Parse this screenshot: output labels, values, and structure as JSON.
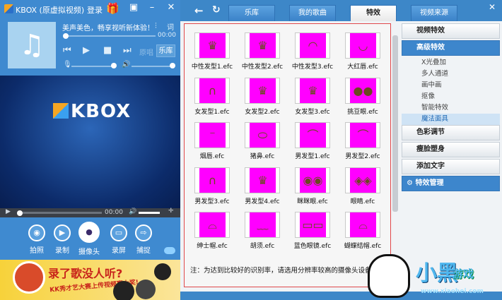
{
  "app": {
    "title": "KBOX (原虚拟视频)",
    "login": "登录",
    "gift_icon": "gift-icon"
  },
  "player": {
    "slogan": "美声美色，畅享视听新体验！",
    "lyrics": "词",
    "time": "00:00",
    "original": "原唱",
    "library": "乐库"
  },
  "video": {
    "logo": "KBOX",
    "time": "00:00"
  },
  "tools": [
    {
      "label": "拍照",
      "icon": "◉"
    },
    {
      "label": "录制",
      "icon": "▶"
    },
    {
      "label": "摄像头",
      "icon": "●"
    },
    {
      "label": "录屏",
      "icon": "▭"
    },
    {
      "label": "捕捉",
      "icon": "⇨"
    }
  ],
  "ad": {
    "headline": "录了歌没人听?",
    "sub": "KK秀才艺大赛上传视频赢大奖!"
  },
  "tabs": [
    "乐库",
    "我的歌曲",
    "特效",
    "视频来源"
  ],
  "effects": [
    {
      "label": "中性发型1.efc",
      "g": "♛"
    },
    {
      "label": "中性发型2.efc",
      "g": "♛"
    },
    {
      "label": "中性发型3.efc",
      "g": "◠"
    },
    {
      "label": "大红唇.efc",
      "g": "◡"
    },
    {
      "label": "女发型1.efc",
      "g": "∩"
    },
    {
      "label": "女发型2.efc",
      "g": "♛"
    },
    {
      "label": "女发型3.efc",
      "g": "♛"
    },
    {
      "label": "挑豆眼.efc",
      "g": "●●"
    },
    {
      "label": "烟唇.efc",
      "g": "⁻"
    },
    {
      "label": "猪鼻.efc",
      "g": "⬭"
    },
    {
      "label": "男发型1.efc",
      "g": "⌒"
    },
    {
      "label": "男发型2.efc",
      "g": "⌒"
    },
    {
      "label": "男发型3.efc",
      "g": "∩"
    },
    {
      "label": "男发型4.efc",
      "g": "♛"
    },
    {
      "label": "眯眯眼.efc",
      "g": "◉◉"
    },
    {
      "label": "眼睛.efc",
      "g": "◈◈"
    },
    {
      "label": "绅士帽.efc",
      "g": "⌓"
    },
    {
      "label": "胡须.efc",
      "g": "﹏"
    },
    {
      "label": "蓝色眼镜.efc",
      "g": "▭▭"
    },
    {
      "label": "蝴蝶结帽.efc",
      "g": "⌓"
    }
  ],
  "note": "注：为达到比较好的识别率，请选用分辨率较高的摄像头设备。",
  "sidebar": {
    "video_effects": "视频特效",
    "advanced": "高级特效",
    "subs": [
      "X光叠加",
      "多人通道",
      "画中画",
      "抠像",
      "智能特效",
      "魔法面具"
    ],
    "color": "色彩调节",
    "face": "瘦脸塑身",
    "text": "添加文字",
    "manage": "特效管理"
  },
  "watermark": {
    "name": "小黑",
    "games": "游戏",
    "url": "www.xiaohei.com"
  }
}
